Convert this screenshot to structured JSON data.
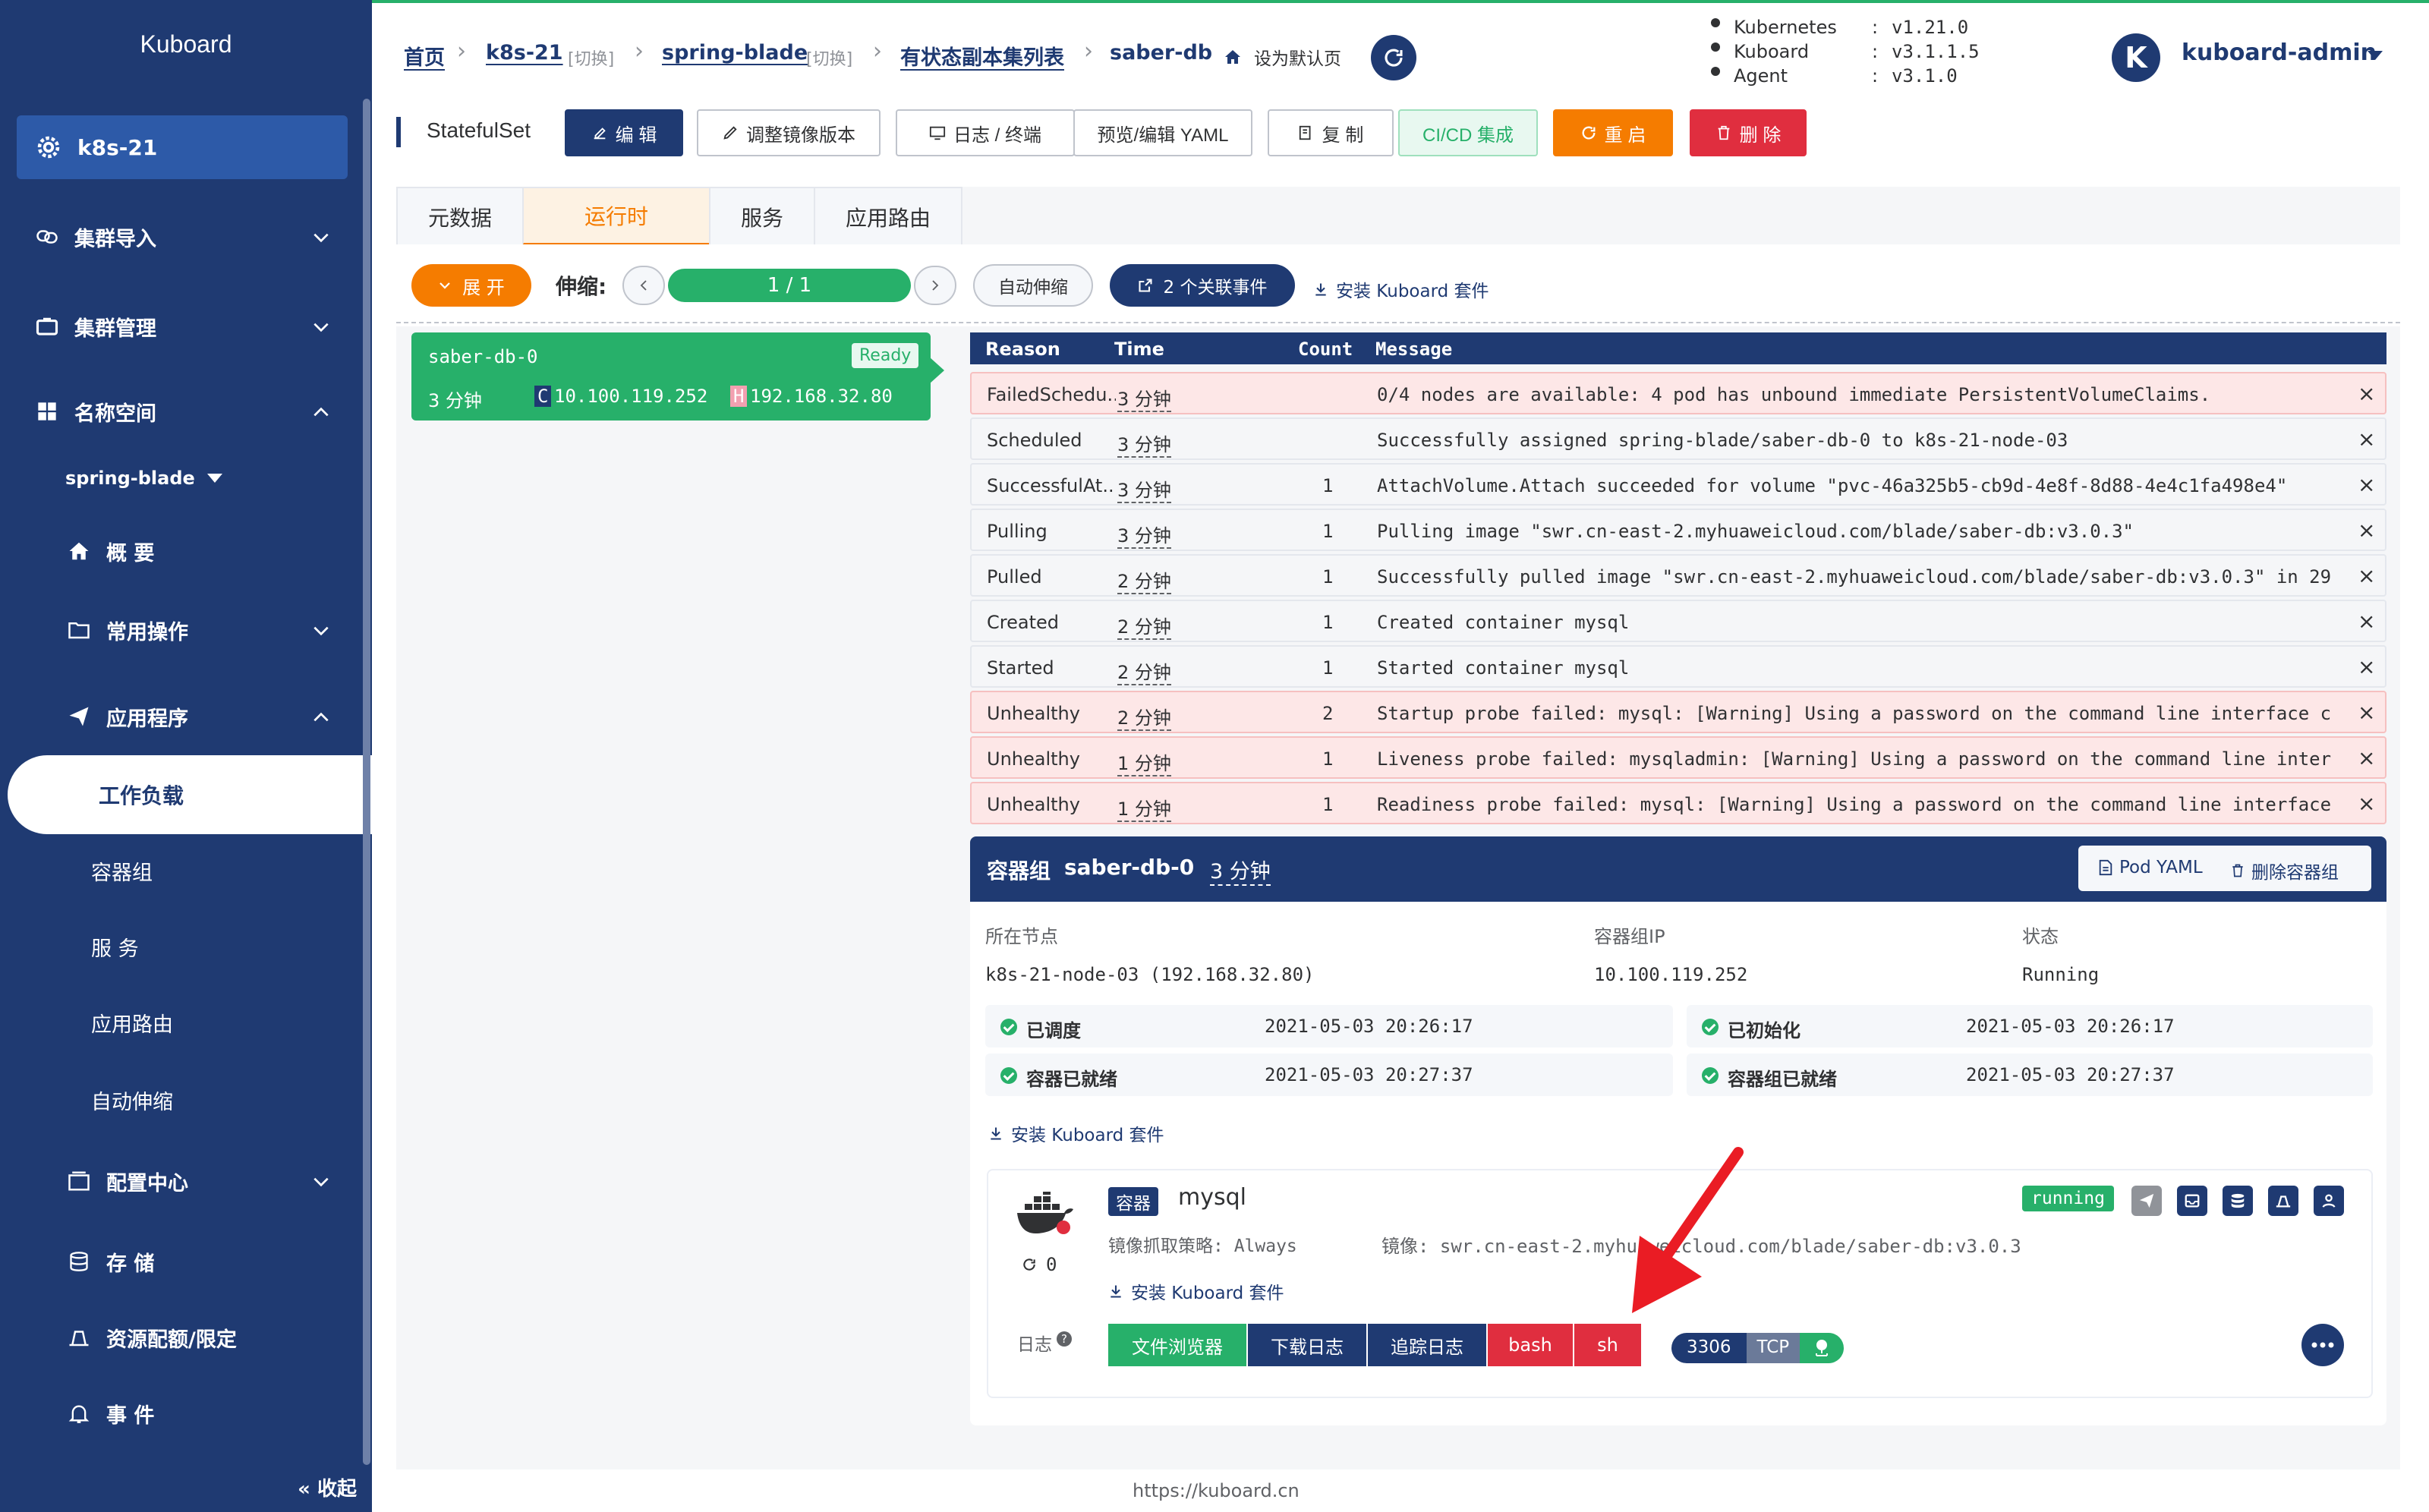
{
  "sidebar": {
    "brand": "Kuboard",
    "cluster": "k8s-21",
    "items": [
      {
        "label": "集群导入"
      },
      {
        "label": "集群管理"
      },
      {
        "label": "名称空间"
      },
      {
        "label": "spring-blade"
      },
      {
        "label": "概 要"
      },
      {
        "label": "常用操作"
      },
      {
        "label": "应用程序"
      },
      {
        "label": "工作负载"
      },
      {
        "label": "容器组"
      },
      {
        "label": "服 务"
      },
      {
        "label": "应用路由"
      },
      {
        "label": "自动伸缩"
      },
      {
        "label": "配置中心"
      },
      {
        "label": "存 储"
      },
      {
        "label": "资源配额/限定"
      },
      {
        "label": "事 件"
      }
    ],
    "collapse": "« 收起"
  },
  "breadcrumb": {
    "home": "首页",
    "cluster": "k8s-21",
    "switch1": "[切换]",
    "namespace": "spring-blade",
    "switch2": "[切换]",
    "list": "有状态副本集列表",
    "current": "saber-db",
    "set_default": "设为默认页"
  },
  "versions": {
    "k8s_label": "Kubernetes",
    "k8s": "v1.21.0",
    "kuboard_label": "Kuboard",
    "kuboard": "v3.1.1.5",
    "agent_label": "Agent",
    "agent": "v3.1.0",
    "colon": ":"
  },
  "user": {
    "avatar": "K",
    "name": "kuboard-admin"
  },
  "toolbar": {
    "kind": "StatefulSet",
    "edit": "编 辑",
    "image": "调整镜像版本",
    "logs": "日志 / 终端",
    "yaml": "预览/编辑 YAML",
    "copy": "复 制",
    "cicd": "CI/CD 集成",
    "restart": "重 启",
    "delete": "删 除"
  },
  "tabs": [
    "元数据",
    "运行时",
    "服务",
    "应用路由"
  ],
  "runtime": {
    "expand": "展 开",
    "scale_label": "伸缩:",
    "replicas": "1 / 1",
    "autoscale": "自动伸缩",
    "events_btn": "2 个关联事件",
    "install": "安装 Kuboard 套件"
  },
  "pod_card": {
    "name": "saber-db-0",
    "status": "Ready",
    "age": "3 分钟",
    "c_tag": "C",
    "pod_ip": "10.100.119.252",
    "h_tag": "H",
    "host_ip": "192.168.32.80"
  },
  "events": {
    "headers": [
      "Reason",
      "Time",
      "Count",
      "Message"
    ],
    "close": "×",
    "rows": [
      {
        "reason": "FailedSchedu...",
        "time": "3 分钟",
        "count": "",
        "message": "0/4 nodes are available: 4 pod has unbound immediate PersistentVolumeClaims.",
        "warn": true
      },
      {
        "reason": "Scheduled",
        "time": "3 分钟",
        "count": "",
        "message": "Successfully assigned spring-blade/saber-db-0 to k8s-21-node-03",
        "warn": false
      },
      {
        "reason": "SuccessfulAt...",
        "time": "3 分钟",
        "count": "1",
        "message": "AttachVolume.Attach succeeded for volume \"pvc-46a325b5-cb9d-4e8f-8d88-4e4c1fa498e4\"",
        "warn": false
      },
      {
        "reason": "Pulling",
        "time": "3 分钟",
        "count": "1",
        "message": "Pulling image \"swr.cn-east-2.myhuaweicloud.com/blade/saber-db:v3.0.3\"",
        "warn": false
      },
      {
        "reason": "Pulled",
        "time": "2 分钟",
        "count": "1",
        "message": "Successfully pulled image \"swr.cn-east-2.myhuaweicloud.com/blade/saber-db:v3.0.3\" in 29...",
        "warn": false
      },
      {
        "reason": "Created",
        "time": "2 分钟",
        "count": "1",
        "message": "Created container mysql",
        "warn": false
      },
      {
        "reason": "Started",
        "time": "2 分钟",
        "count": "1",
        "message": "Started container mysql",
        "warn": false
      },
      {
        "reason": "Unhealthy",
        "time": "2 分钟",
        "count": "2",
        "message": "Startup probe failed: mysql: [Warning] Using a password on the command line interface c...",
        "warn": true
      },
      {
        "reason": "Unhealthy",
        "time": "1 分钟",
        "count": "1",
        "message": "Liveness probe failed: mysqladmin: [Warning] Using a password on the command line inter...",
        "warn": true
      },
      {
        "reason": "Unhealthy",
        "time": "1 分钟",
        "count": "1",
        "message": "Readiness probe failed: mysql: [Warning] Using a password on the command line interface...",
        "warn": true
      }
    ]
  },
  "pod_detail": {
    "title": "容器组",
    "name": "saber-db-0",
    "age": "3 分钟",
    "pod_yaml": "Pod YAML",
    "delete_pod": "删除容器组",
    "node_label": "所在节点",
    "node": "k8s-21-node-03 (192.168.32.80)",
    "ip_label": "容器组IP",
    "ip": "10.100.119.252",
    "status_label": "状态",
    "status": "Running",
    "conditions": [
      {
        "label": "已调度",
        "time": "2021-05-03 20:26:17"
      },
      {
        "label": "已初始化",
        "time": "2021-05-03 20:26:17"
      },
      {
        "label": "容器已就绪",
        "time": "2021-05-03 20:27:37"
      },
      {
        "label": "容器组已就绪",
        "time": "2021-05-03 20:27:37"
      }
    ],
    "install": "安装 Kuboard 套件"
  },
  "container": {
    "tag": "容器",
    "name": "mysql",
    "status": "running",
    "pull_policy": "镜像抓取策略: Always",
    "image": "镜像: swr.cn-east-2.myhuaweicloud.com/blade/saber-db:v3.0.3",
    "restarts": "0",
    "install": "安装 Kuboard 套件",
    "log_label": "日志",
    "buttons": [
      "文件浏览器",
      "下载日志",
      "追踪日志",
      "bash",
      "sh"
    ],
    "port": "3306",
    "protocol": "TCP"
  },
  "footer": "https://kuboard.cn",
  "colors": {
    "navy": "#1f3a72",
    "green": "#27b06a",
    "orange": "#f57c00",
    "red": "#e02e3f"
  }
}
